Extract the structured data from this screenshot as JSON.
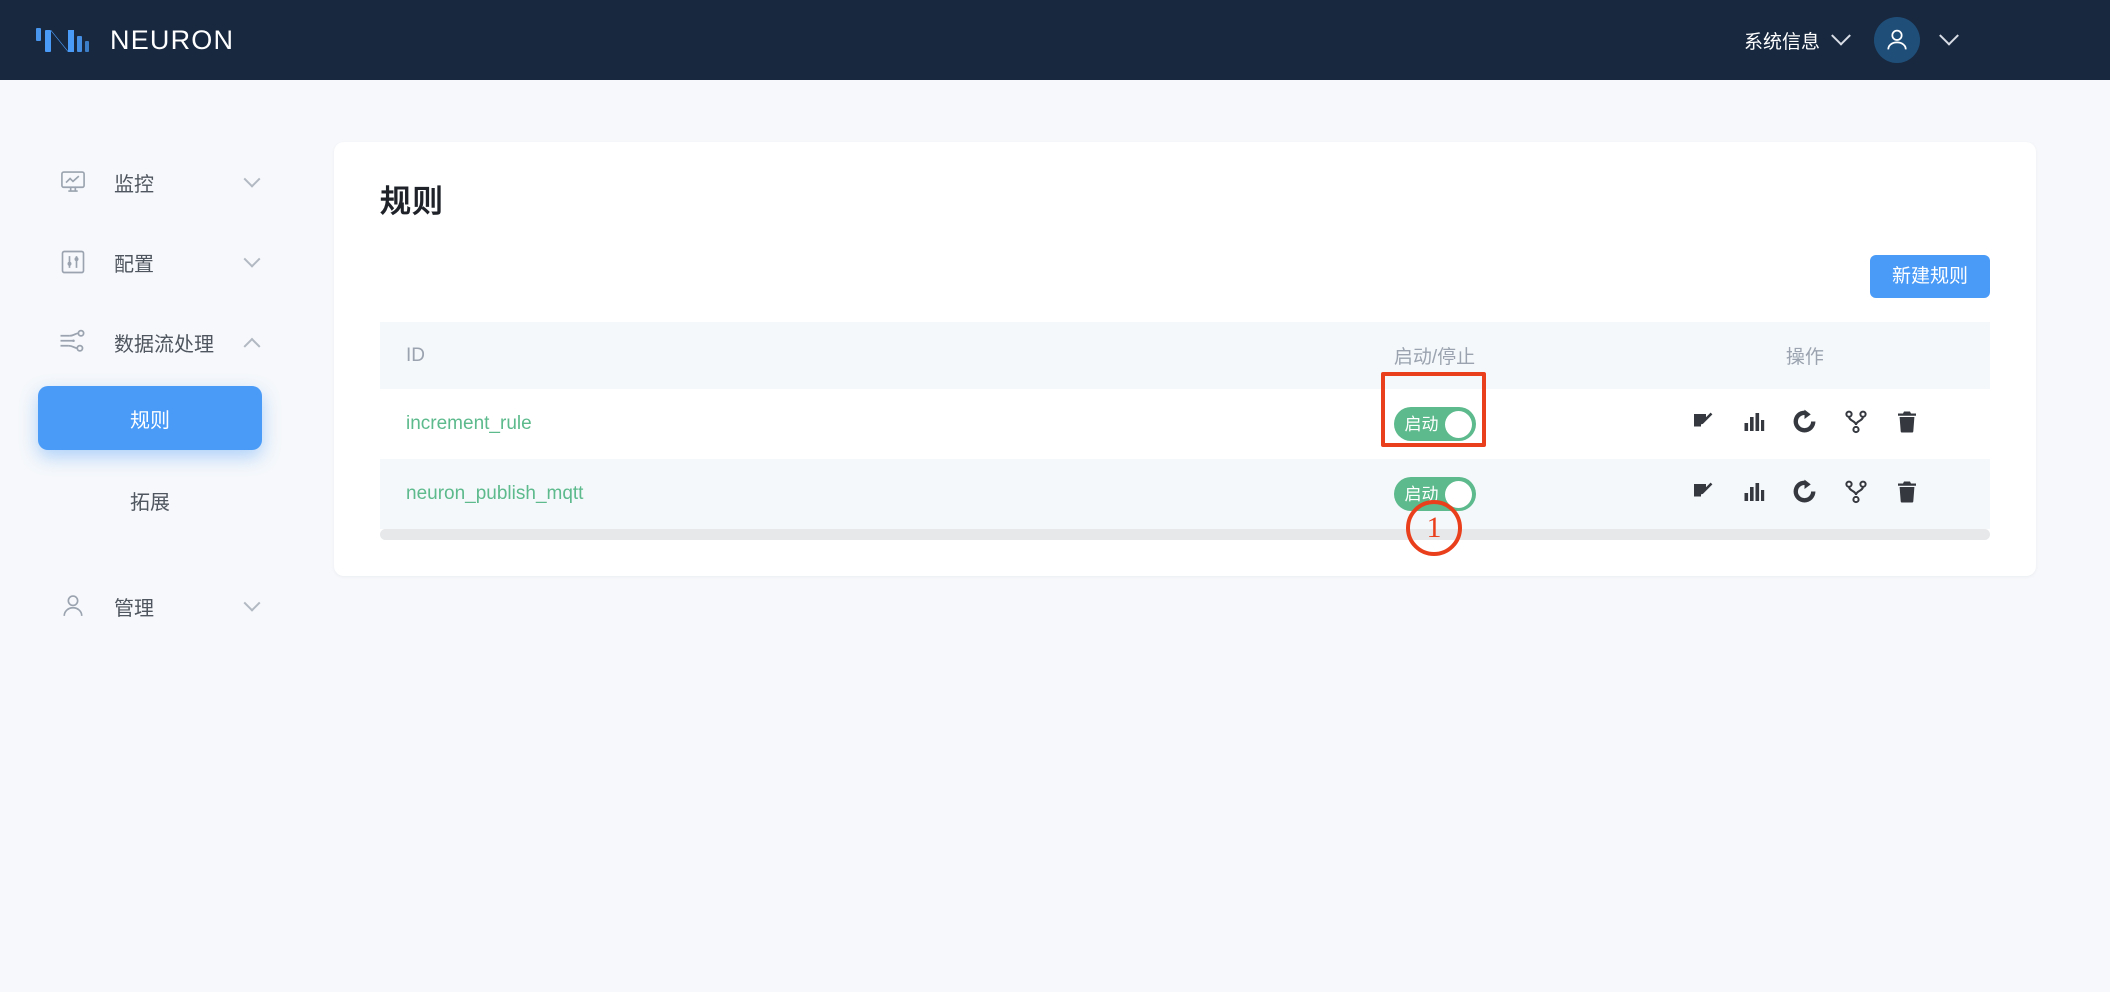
{
  "header": {
    "brand": "NEURON",
    "brand_logo_icon": "neuron-logo-icon",
    "system_info_label": "系统信息",
    "system_info_caret_icon": "chevron-down-icon",
    "avatar_icon": "user-avatar-icon",
    "avatar_caret_icon": "chevron-down-icon",
    "background_color": "#18283f",
    "accent_color": "#4a9bf7"
  },
  "sidebar": {
    "groups": [
      {
        "id": "monitor",
        "label": "监控",
        "icon": "monitor-chart-icon",
        "expanded": false,
        "caret_icon": "chevron-down-icon",
        "children": []
      },
      {
        "id": "config",
        "label": "配置",
        "icon": "sliders-icon",
        "expanded": false,
        "caret_icon": "chevron-down-icon",
        "children": []
      },
      {
        "id": "dataflow",
        "label": "数据流处理",
        "icon": "data-flow-icon",
        "expanded": true,
        "caret_icon": "chevron-up-icon",
        "children": [
          {
            "id": "rules",
            "label": "规则",
            "active": true
          },
          {
            "id": "extensions",
            "label": "拓展",
            "active": false
          }
        ]
      },
      {
        "id": "management",
        "label": "管理",
        "icon": "user-icon",
        "expanded": false,
        "caret_icon": "chevron-down-icon",
        "children": []
      }
    ],
    "active_color": "#4a9bf7"
  },
  "main": {
    "page_title": "规则",
    "new_rule_button": "新建规则",
    "table": {
      "columns": [
        "ID",
        "启动/停止",
        "操作"
      ],
      "rows": [
        {
          "id": "increment_rule",
          "toggle_label": "启动",
          "toggle_on": true,
          "ops": [
            "edit-icon",
            "chart-bar-icon",
            "restart-icon",
            "topology-branch-icon",
            "trash-icon"
          ]
        },
        {
          "id": "neuron_publish_mqtt",
          "toggle_label": "启动",
          "toggle_on": true,
          "ops": [
            "edit-icon",
            "chart-bar-icon",
            "restart-icon",
            "topology-branch-icon",
            "trash-icon"
          ]
        }
      ],
      "row_link_color": "#5cba8c",
      "toggle_on_color": "#5cba8c"
    }
  },
  "annotations": {
    "highlight_color": "#ea3f1c",
    "items": [
      {
        "id": "step-1",
        "badge": "1",
        "target": "start-stop-toggle-column"
      }
    ]
  }
}
